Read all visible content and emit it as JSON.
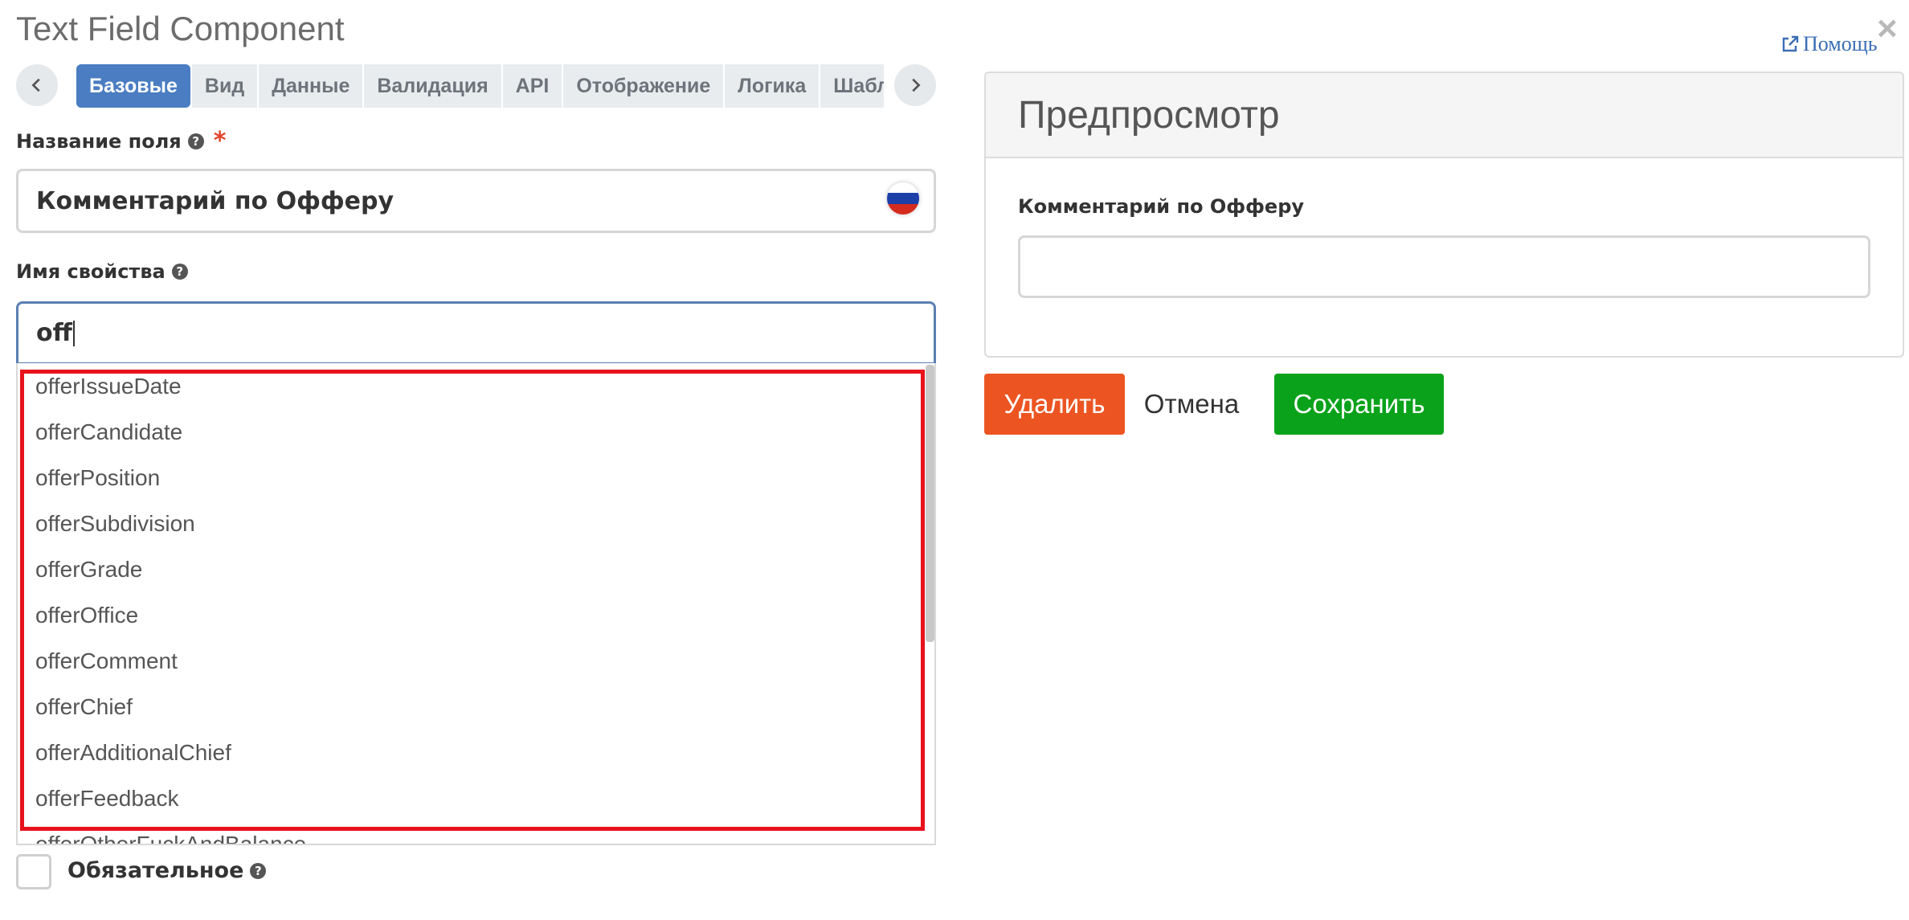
{
  "header": {
    "title": "Text Field Component",
    "help_label": "Помощь",
    "close_glyph": "×"
  },
  "tabs": [
    {
      "label": "Базовые",
      "active": true
    },
    {
      "label": "Вид",
      "active": false
    },
    {
      "label": "Данные",
      "active": false
    },
    {
      "label": "Валидация",
      "active": false
    },
    {
      "label": "API",
      "active": false
    },
    {
      "label": "Отображение",
      "active": false
    },
    {
      "label": "Логика",
      "active": false
    },
    {
      "label": "Шаблон",
      "active": false
    }
  ],
  "field_name": {
    "label": "Название поля",
    "required_mark": "*",
    "value": "Комментарий по Офферу",
    "flag_colors": [
      "#ffffff",
      "#1c3fa8",
      "#d52b1e"
    ]
  },
  "property_name": {
    "label": "Имя свойства",
    "value": "off"
  },
  "autocomplete": {
    "items": [
      "offerIssueDate",
      "offerCandidate",
      "offerPosition",
      "offerSubdivision",
      "offerGrade",
      "offerOffice",
      "offerComment",
      "offerChief",
      "offerAdditionalChief",
      "offerFeedback",
      "offerOtherFuckAndBalance"
    ],
    "highlight_color": "#e8121c"
  },
  "required_checkbox": {
    "label": "Обязательное",
    "checked": false
  },
  "preview": {
    "title": "Предпросмотр",
    "field_label": "Комментарий по Офферу",
    "field_value": ""
  },
  "actions": {
    "delete_label": "Удалить",
    "cancel_label": "Отмена",
    "save_label": "Сохранить",
    "delete_color": "#ec5522",
    "save_color": "#0aa21a"
  }
}
